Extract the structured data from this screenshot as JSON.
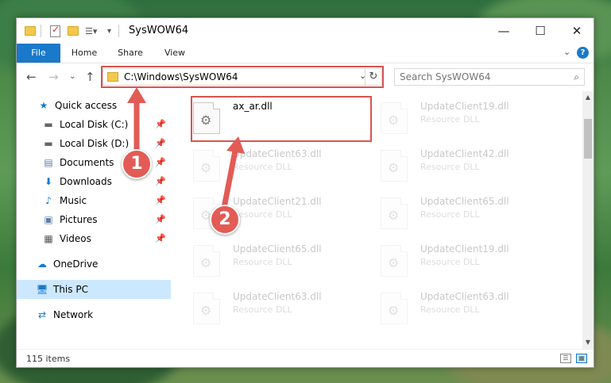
{
  "window": {
    "title": "SysWOW64",
    "minimize_icon": "minimize-icon",
    "maximize_icon": "maximize-icon",
    "close_icon": "close-icon"
  },
  "ribbon": {
    "tabs": [
      {
        "label": "File"
      },
      {
        "label": "Home"
      },
      {
        "label": "Share"
      },
      {
        "label": "View"
      }
    ],
    "help_label": "?"
  },
  "navigation": {
    "address": "C:\\Windows\\SysWOW64",
    "search_placeholder": "Search SysWOW64"
  },
  "sidebar": {
    "items": [
      {
        "label": "Quick access",
        "icon": "star-icon",
        "pinned": false
      },
      {
        "label": "Local Disk (C:)",
        "icon": "drive-icon",
        "pinned": true
      },
      {
        "label": "Local Disk (D:)",
        "icon": "drive-icon",
        "pinned": true
      },
      {
        "label": "Documents",
        "icon": "documents-icon",
        "pinned": true
      },
      {
        "label": "Downloads",
        "icon": "download-icon",
        "pinned": true
      },
      {
        "label": "Music",
        "icon": "music-icon",
        "pinned": true
      },
      {
        "label": "Pictures",
        "icon": "pictures-icon",
        "pinned": true
      },
      {
        "label": "Videos",
        "icon": "videos-icon",
        "pinned": true
      },
      {
        "label": "OneDrive",
        "icon": "cloud-icon",
        "pinned": false
      },
      {
        "label": "This PC",
        "icon": "computer-icon",
        "pinned": false,
        "selected": true
      },
      {
        "label": "Network",
        "icon": "network-icon",
        "pinned": false
      }
    ]
  },
  "files": [
    {
      "name": "ax_ar.dll",
      "type": ""
    },
    {
      "name": "UpdateClient19.dll",
      "type": "Resource DLL"
    },
    {
      "name": "UpdateClient63.dll",
      "type": "Resource DLL"
    },
    {
      "name": "UpdateClient42.dll",
      "type": "Resource DLL"
    },
    {
      "name": "UpdateClient21.dll",
      "type": "Resource DLL"
    },
    {
      "name": "UpdateClient65.dll",
      "type": "Resource DLL"
    },
    {
      "name": "UpdateClient65.dll",
      "type": "Resource DLL"
    },
    {
      "name": "UpdateClient19.dll",
      "type": "Resource DLL"
    },
    {
      "name": "UpdateClient63.dll",
      "type": "Resource DLL"
    },
    {
      "name": "UpdateClient63.dll",
      "type": "Resource DLL"
    }
  ],
  "status": {
    "item_count": "115 items"
  },
  "callouts": [
    {
      "number": "1"
    },
    {
      "number": "2"
    }
  ],
  "colors": {
    "accent": "#1979ca",
    "highlight_box": "#d9534f",
    "callout": "#e35b55",
    "selected_bg": "#cce8ff"
  }
}
